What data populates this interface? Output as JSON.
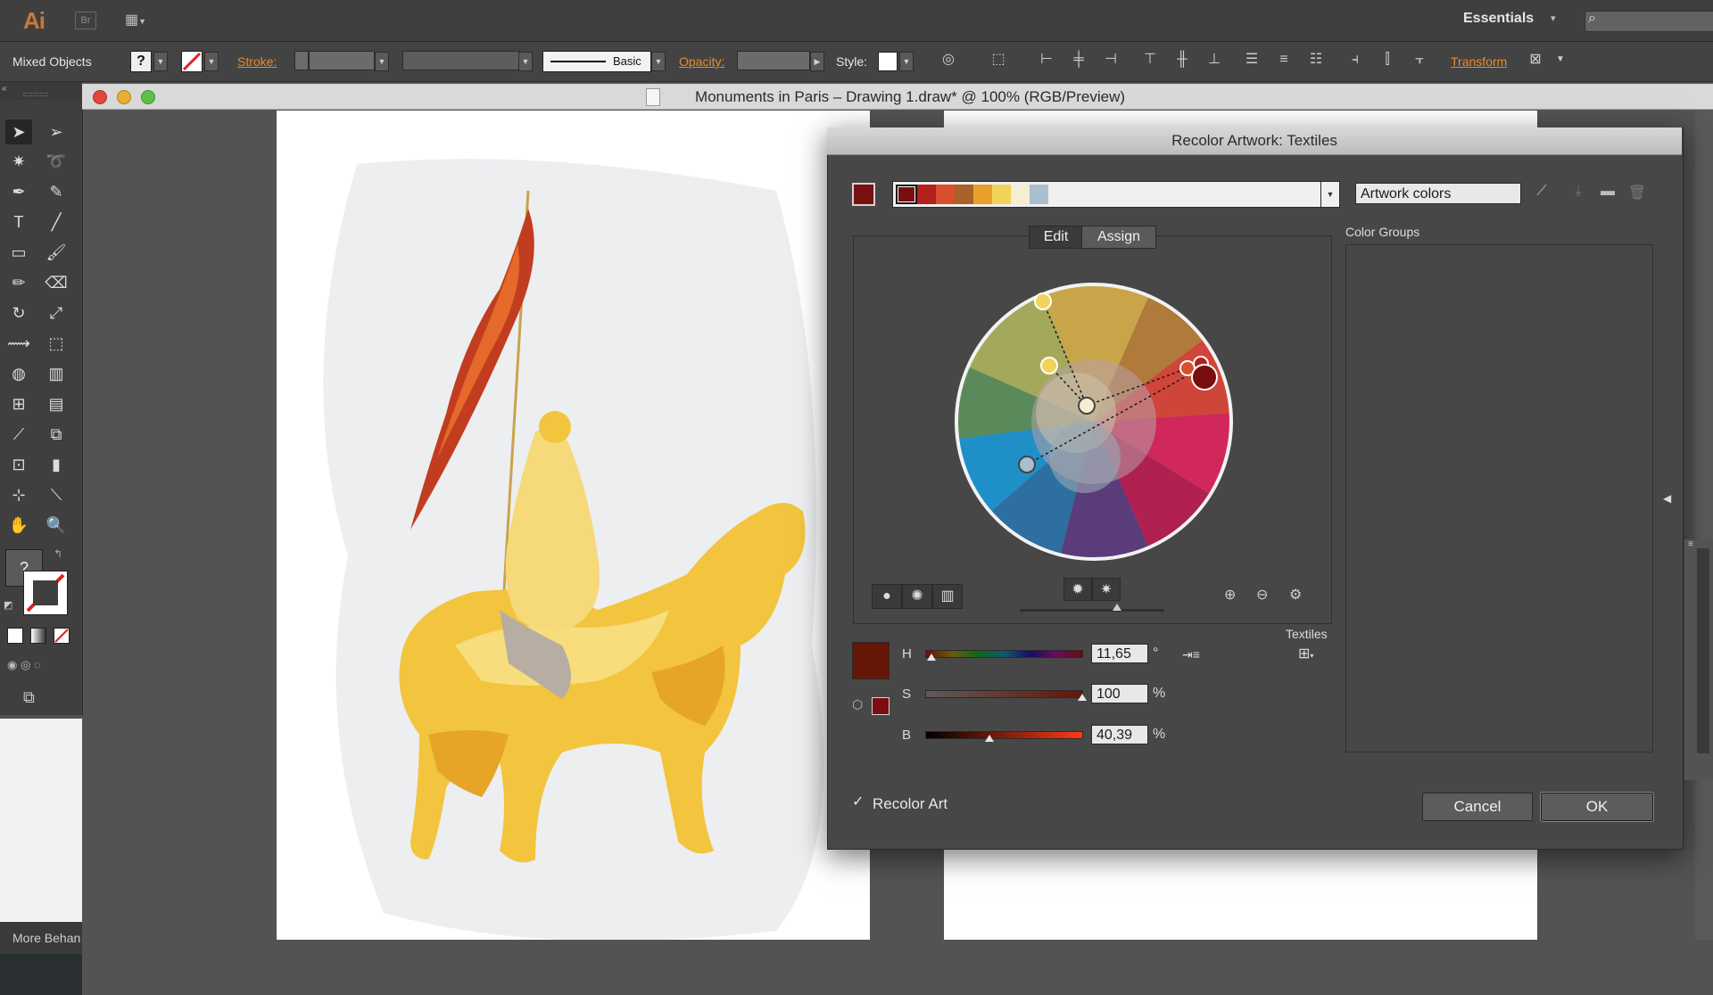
{
  "app": {
    "logo": "Ai",
    "bridge": "Br",
    "workspace": "Essentials"
  },
  "controlbar": {
    "selection": "Mixed Objects",
    "stroke_label": "Stroke:",
    "brush": "Basic",
    "opacity_label": "Opacity:",
    "style_label": "Style:",
    "transform_label": "Transform"
  },
  "document": {
    "title": "Monuments in Paris – Drawing 1.draw* @ 100% (RGB/Preview)"
  },
  "left": {
    "more_behance": "More Behan"
  },
  "dialog": {
    "title": "Recolor Artwork: Textiles",
    "artwork_colors": "Artwork colors",
    "tabs": {
      "edit": "Edit",
      "assign": "Assign"
    },
    "color_groups_label": "Color Groups",
    "colors": [
      "#7a0e0e",
      "#b3201d",
      "#d84f2c",
      "#a8622a",
      "#e8a02a",
      "#f2d35a",
      "#f6eed2",
      "#a9bfcf"
    ],
    "hsb": {
      "h_label": "H",
      "h_value": "11,65",
      "h_unit": "°",
      "h_fraction": 0.033,
      "s_label": "S",
      "s_value": "100",
      "s_unit": "%",
      "s_fraction": 1.0,
      "b_label": "B",
      "b_value": "40,39",
      "b_unit": "%",
      "b_fraction": 0.404
    },
    "library_label": "Textiles",
    "recolor_art": "Recolor Art",
    "cancel": "Cancel",
    "ok": "OK"
  }
}
